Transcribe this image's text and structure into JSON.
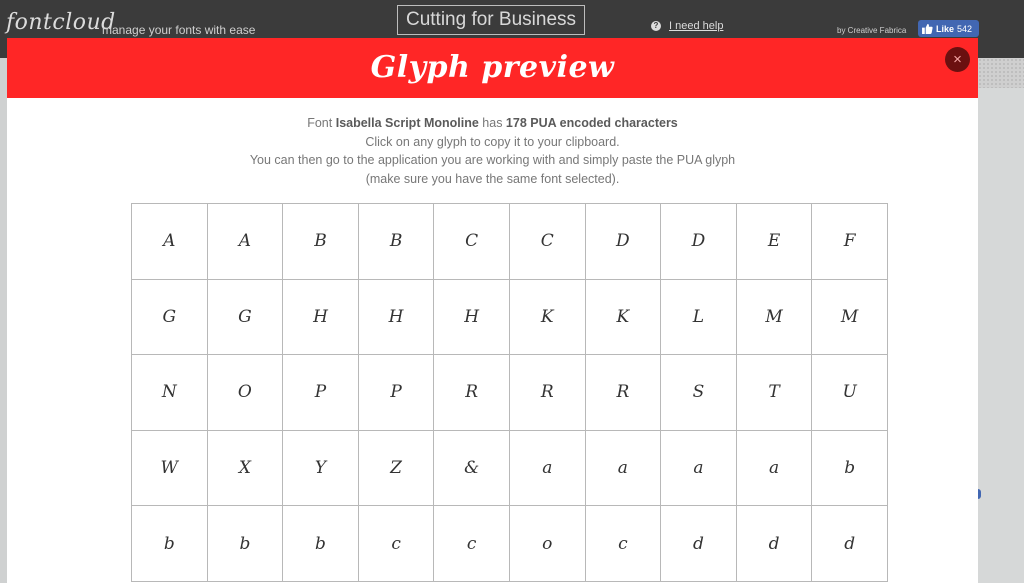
{
  "topbar": {
    "logo": "fontcloud",
    "tagline": "manage your fonts with ease",
    "business_button": "Cutting for Business",
    "help_icon": "question-circle-icon",
    "help_label": "I need help",
    "byline": "by Creative Fabrica",
    "like_label": "Like",
    "like_count": "542"
  },
  "modal": {
    "title": "Glyph preview",
    "close_label": "×",
    "info": {
      "prefix": "Font ",
      "font_name": "Isabella Script Monoline",
      "middle": " has ",
      "count_text": "178 PUA encoded characters",
      "line2": "Click on any glyph to copy it to your clipboard.",
      "line3": "You can then go to the application you are working with and simply paste the PUA glyph",
      "line4": "(make sure you have the same font selected)."
    },
    "glyphs": [
      "A",
      "A",
      "B",
      "B",
      "C",
      "C",
      "D",
      "D",
      "E",
      "F",
      "G",
      "G",
      "H",
      "H",
      "H",
      "K",
      "K",
      "L",
      "M",
      "M",
      "N",
      "O",
      "P",
      "P",
      "R",
      "R",
      "R",
      "S",
      "T",
      "U",
      "W",
      "X",
      "Y",
      "Z",
      "&",
      "a",
      "a",
      "a",
      "a",
      "b",
      "b",
      "b",
      "b",
      "c",
      "c",
      "o",
      "c",
      "d",
      "d",
      "d"
    ]
  },
  "colors": {
    "header_red": "#ff2626",
    "topbar_dark": "#3b3b3b",
    "close_dark_red": "#6b1010",
    "facebook_blue": "#4267b2"
  }
}
